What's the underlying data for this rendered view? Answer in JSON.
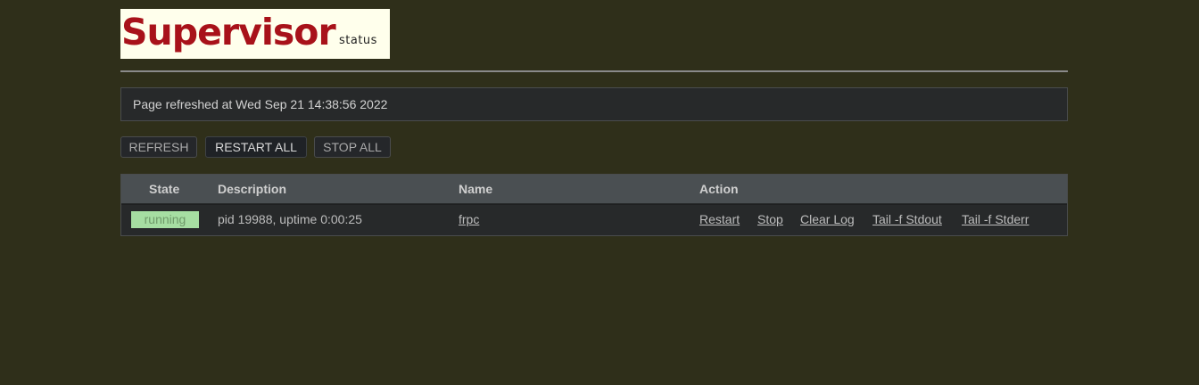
{
  "logo": {
    "main": "Supervisor",
    "sub": "status"
  },
  "status_message": "Page refreshed at Wed Sep 21 14:38:56 2022",
  "toolbar": {
    "refresh": "REFRESH",
    "restart_all": "RESTART ALL",
    "stop_all": "STOP ALL"
  },
  "table": {
    "headers": {
      "state": "State",
      "description": "Description",
      "name": "Name",
      "action": "Action"
    },
    "rows": [
      {
        "state": "running",
        "description": "pid 19988, uptime 0:00:25",
        "name": "frpc",
        "actions": [
          "Restart",
          "Stop",
          "Clear Log",
          "Tail -f Stdout",
          "Tail -f Stderr"
        ]
      }
    ]
  },
  "colors": {
    "background": "#2f2f1a",
    "logo_red": "#a8121a",
    "running_badge": "#a6dea2"
  }
}
